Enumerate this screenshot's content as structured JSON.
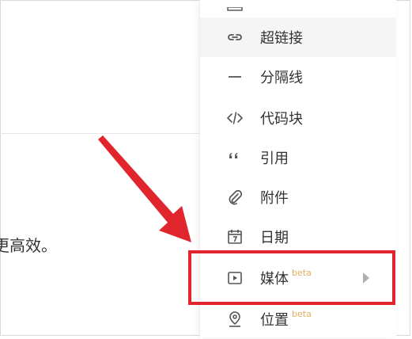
{
  "content": {
    "partial_text": "更高效。"
  },
  "menu": {
    "items": [
      {
        "label": "超链接",
        "icon": "link-icon",
        "beta": ""
      },
      {
        "label": "分隔线",
        "icon": "divider-icon",
        "beta": ""
      },
      {
        "label": "代码块",
        "icon": "code-block-icon",
        "beta": ""
      },
      {
        "label": "引用",
        "icon": "quote-icon",
        "beta": ""
      },
      {
        "label": "附件",
        "icon": "attachment-icon",
        "beta": ""
      },
      {
        "label": "日期",
        "icon": "calendar-icon",
        "beta": ""
      },
      {
        "label": "媒体",
        "icon": "media-icon",
        "beta": "beta"
      },
      {
        "label": "位置",
        "icon": "location-icon",
        "beta": "beta"
      }
    ]
  },
  "colors": {
    "highlight": "#e0262c",
    "arrow": "#e0262c",
    "beta": "#e0b060"
  }
}
